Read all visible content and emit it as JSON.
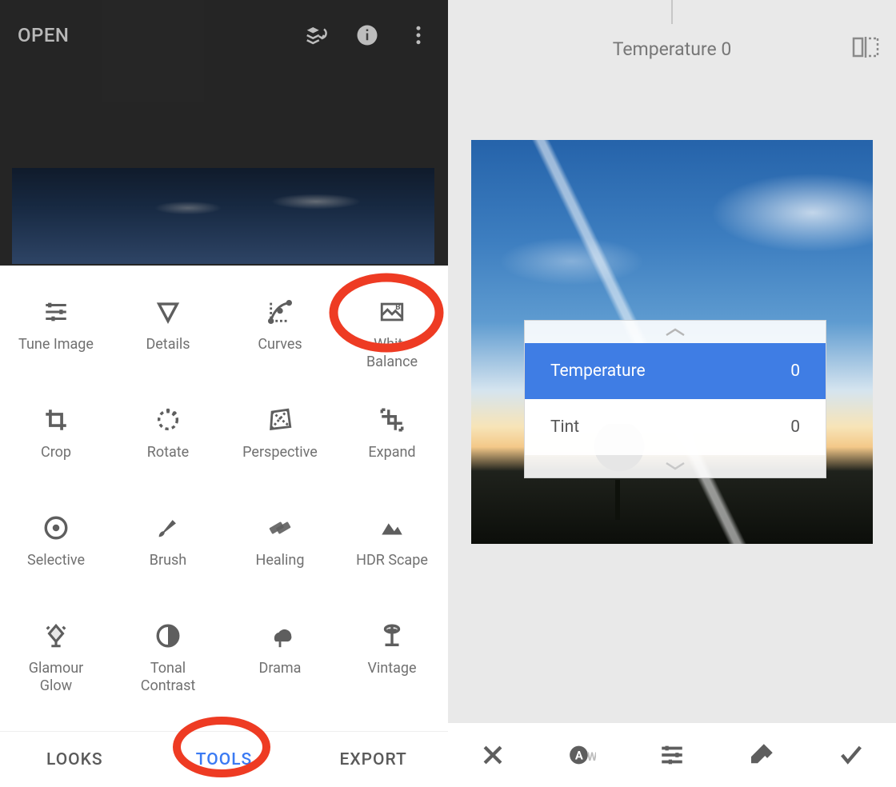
{
  "left": {
    "open_label": "OPEN",
    "tabs": {
      "looks": "LOOKS",
      "tools": "TOOLS",
      "export": "EXPORT"
    },
    "tools": [
      "Tune Image",
      "Details",
      "Curves",
      "White Balance",
      "Crop",
      "Rotate",
      "Perspective",
      "Expand",
      "Selective",
      "Brush",
      "Healing",
      "HDR Scape",
      "Glamour Glow",
      "Tonal Contrast",
      "Drama",
      "Vintage"
    ]
  },
  "right": {
    "param_header": "Temperature 0",
    "rows": [
      {
        "name": "Temperature",
        "value": "0",
        "selected": true
      },
      {
        "name": "Tint",
        "value": "0",
        "selected": false
      }
    ],
    "bottom_icons": [
      "close",
      "auto-white",
      "adjust",
      "eyedropper",
      "apply"
    ]
  },
  "colors": {
    "accent": "#3a7af3",
    "selRow": "#3f7de4",
    "annot": "#ee3b23",
    "icon": "#5e5e5e"
  }
}
